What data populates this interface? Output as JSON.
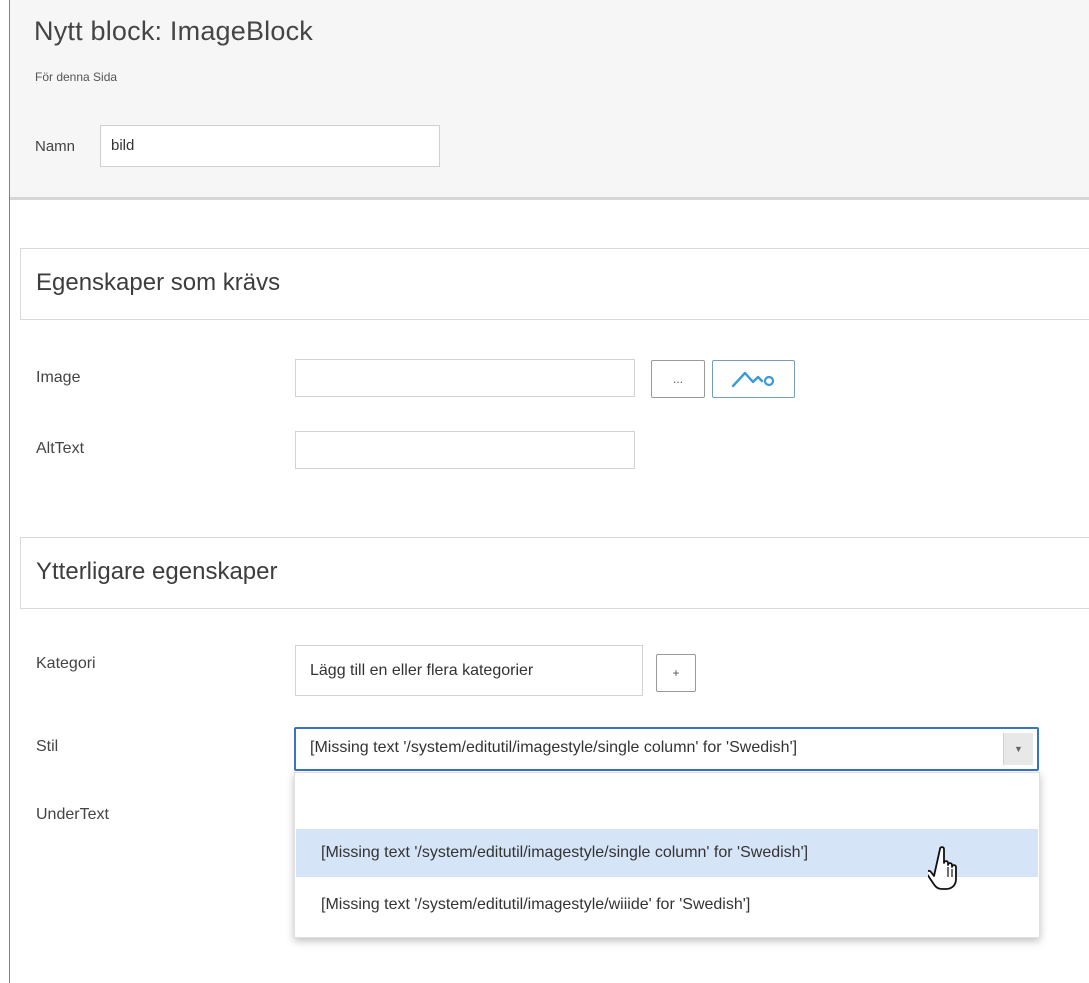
{
  "header": {
    "title": "Nytt block: ImageBlock",
    "subtitle": "För denna Sida",
    "name_label": "Namn",
    "name_value": "bild"
  },
  "required_section": {
    "title": "Egenskaper som krävs",
    "image_label": "Image",
    "browse_button": "...",
    "image_button_icon": "image-mountain-icon",
    "alttext_label": "AltText"
  },
  "additional_section": {
    "title": "Ytterligare egenskaper",
    "kategori_label": "Kategori",
    "kategori_placeholder": "Lägg till en eller flera kategorier",
    "add_button": "+",
    "stil_label": "Stil",
    "stil_selected": "[Missing text '/system/editutil/imagestyle/single column' for 'Swedish']",
    "undertext_label": "UnderText",
    "dropdown_options": [
      "",
      "[Missing text '/system/editutil/imagestyle/single column' for 'Swedish']",
      "[Missing text '/system/editutil/imagestyle/wiiide' for 'Swedish']"
    ]
  },
  "colors": {
    "accent": "#3b73c4",
    "hover": "#d6e4f7",
    "icon": "#3a9ad9"
  }
}
